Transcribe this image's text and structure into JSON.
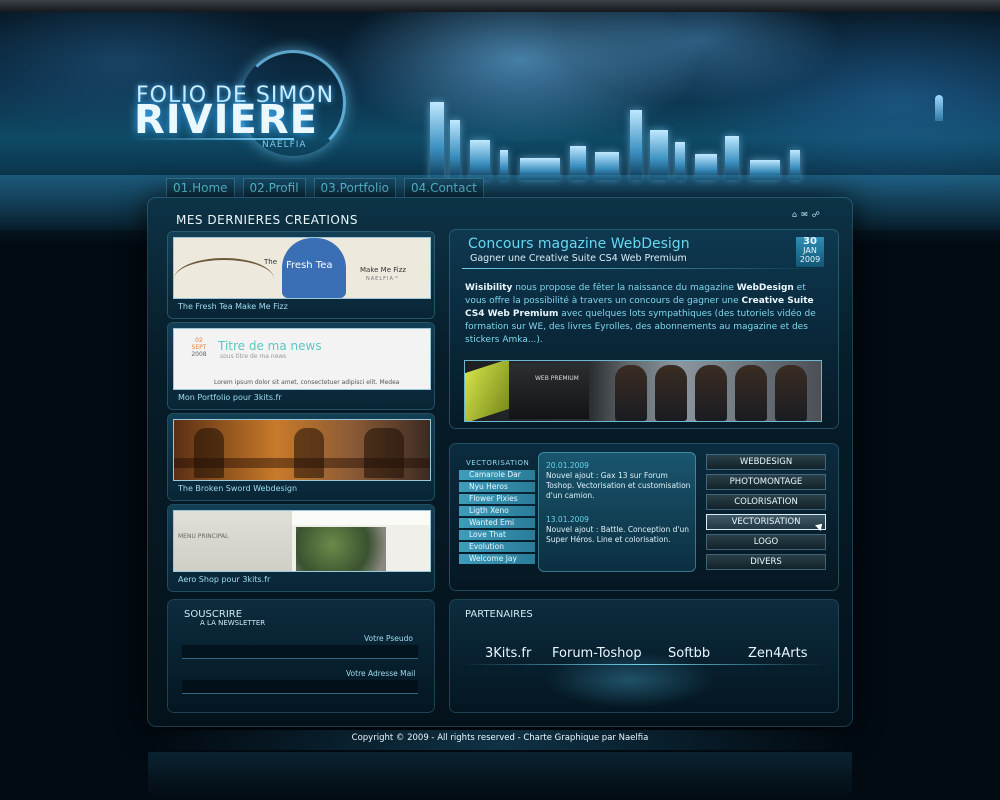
{
  "header": {
    "logo_small": "FOLIO DE SIMON",
    "logo_big": "RIVIERE",
    "logo_signature": "NAELFIA"
  },
  "nav": [
    "01.Home",
    "02.Profil",
    "03.Portfolio",
    "04.Contact"
  ],
  "mini_icons": [
    "home-icon",
    "mail-icon",
    "sitemap-icon"
  ],
  "creations": {
    "title": "MES DERNIERES CREATIONS",
    "items": [
      {
        "caption": "The Fresh Tea Make Me Fizz",
        "thumb": {
          "the": "The",
          "fresh": "Fresh Tea",
          "make": "Make Me Fizz",
          "brand": "NAELFIA™"
        }
      },
      {
        "caption": "Mon Portfolio pour 3kits.fr",
        "thumb": {
          "day": "02",
          "month": "SEPT",
          "year": "2008",
          "title": "Titre de ma news",
          "sub": "sous titre de ma news",
          "lorem": "Lorem ipsum dolor sit amet, consectetuer adipisci elit. Medea"
        }
      },
      {
        "caption": "The Broken Sword Webdesign"
      },
      {
        "caption": "Aero Shop pour 3kits.fr",
        "thumb": {
          "menu": "MENU PRINCIPAL"
        }
      }
    ]
  },
  "news": {
    "title": "Concours magazine WebDesign",
    "subtitle": "Gagner une Creative Suite CS4 Web Premium",
    "date": {
      "day": "30",
      "month": "JAN",
      "year": "2009"
    },
    "body": {
      "b1": "Wisibility",
      "t1": " nous propose de fêter la naissance du magazine ",
      "b2": "WebDesign",
      "t2": " et vous offre la possibilité à travers un concours de gagner une ",
      "b3": "Creative Suite CS4 Web Premium",
      "t3": " avec quelques lots sympathiques (des tutoriels vidéo de formation sur WE, des livres Eyrolles, des abonnements au magazine et des stickers Amka...)."
    },
    "image_text": "WEB PREMIUM"
  },
  "vectorisation": {
    "title": "VECTORISATION",
    "items": [
      "Camarole Dar",
      "Nyu Heros",
      "Flower Pixies",
      "Ligth Xeno",
      "Wanted Emi",
      "Love That",
      "Evolution",
      "Welcome Jay"
    ]
  },
  "updates": [
    {
      "date": "20.01.2009",
      "text": "Nouvel ajout : Gax 13 sur Forum Toshop. Vectorisation et customisation d'un camion."
    },
    {
      "date": "13.01.2009",
      "text": "Nouvel ajout : Battle. Conception d'un Super Héros. Line et colorisation."
    }
  ],
  "categories": {
    "items": [
      "WEBDESIGN",
      "PHOTOMONTAGE",
      "COLORISATION",
      "VECTORISATION",
      "LOGO",
      "DIVERS"
    ],
    "active": "VECTORISATION"
  },
  "newsletter": {
    "title1": "SOUSCRIRE",
    "title2": "A LA NEWSLETTER",
    "pseudo_label": "Votre Pseudo",
    "email_label": "Votre Adresse Mail",
    "pseudo_value": "",
    "email_value": ""
  },
  "partners": {
    "title": "PARTENAIRES",
    "items": [
      "3Kits.fr",
      "Forum-Toshop",
      "Softbb",
      "Zen4Arts"
    ]
  },
  "footer": {
    "copyright": "Copyright © 2009 - All rights reserved - Charte Graphique par Naelfia"
  },
  "colors": {
    "accent": "#66d8f0",
    "panel": "#0b2c3f",
    "background": "#020a12"
  }
}
